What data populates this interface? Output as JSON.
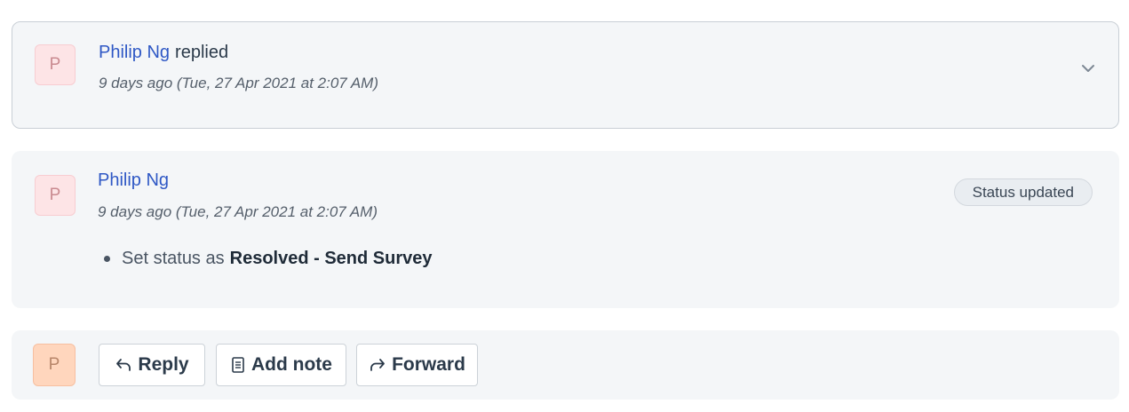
{
  "reply_event": {
    "avatar_initial": "P",
    "author": "Philip Ng",
    "action": "replied",
    "time": "9 days ago (Tue, 27 Apr 2021 at 2:07 AM)",
    "expand_icon": "chevron-down-icon"
  },
  "status_event": {
    "avatar_initial": "P",
    "author": "Philip Ng",
    "time": "9 days ago (Tue, 27 Apr 2021 at 2:07 AM)",
    "badge": "Status updated",
    "change_prefix": "Set status as",
    "change_value": "Resolved - Send Survey"
  },
  "composer": {
    "avatar_initial": "P",
    "reply_label": "Reply",
    "reply_icon": "reply-arrow-icon",
    "note_label": "Add note",
    "note_icon": "note-icon",
    "forward_label": "Forward",
    "forward_icon": "forward-arrow-icon"
  }
}
